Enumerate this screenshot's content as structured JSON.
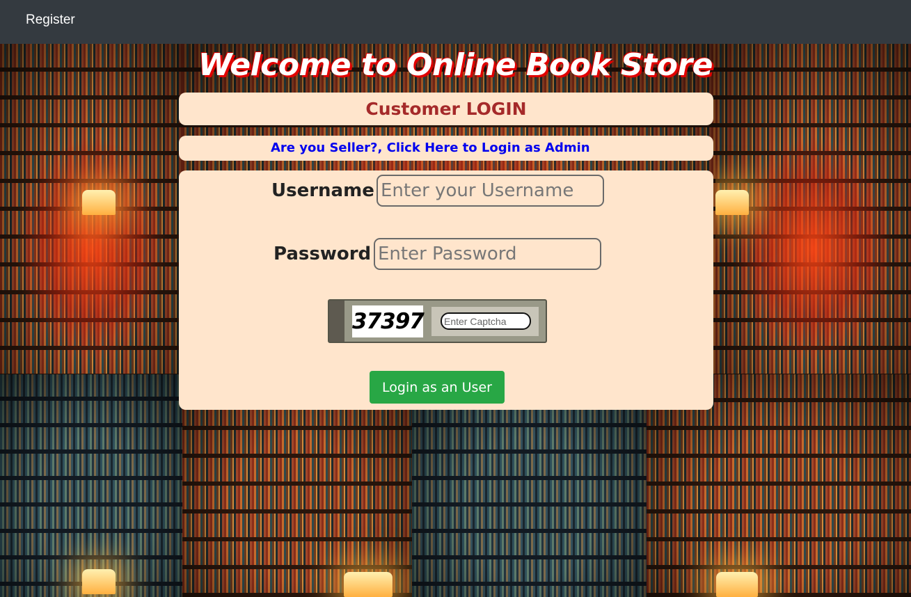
{
  "nav": {
    "register_label": "Register"
  },
  "header": {
    "site_title": "Welcome to Online Book Store"
  },
  "login": {
    "heading": "Customer LOGIN",
    "admin_link": "Are you Seller?, Click Here to Login as Admin",
    "username_label": "Username :",
    "username_placeholder": "Enter your Username",
    "password_label": "Password :",
    "password_placeholder": "Enter Password",
    "captcha_code": "37397",
    "captcha_placeholder": "Enter Captcha",
    "submit_label": "Login as an User"
  },
  "colors": {
    "navbar": "#343a40",
    "panel": "#ffe5cc",
    "heading": "#a52a2a",
    "admin_link": "#0000ee",
    "button": "#28a745",
    "title_shadow": "#e00000"
  }
}
